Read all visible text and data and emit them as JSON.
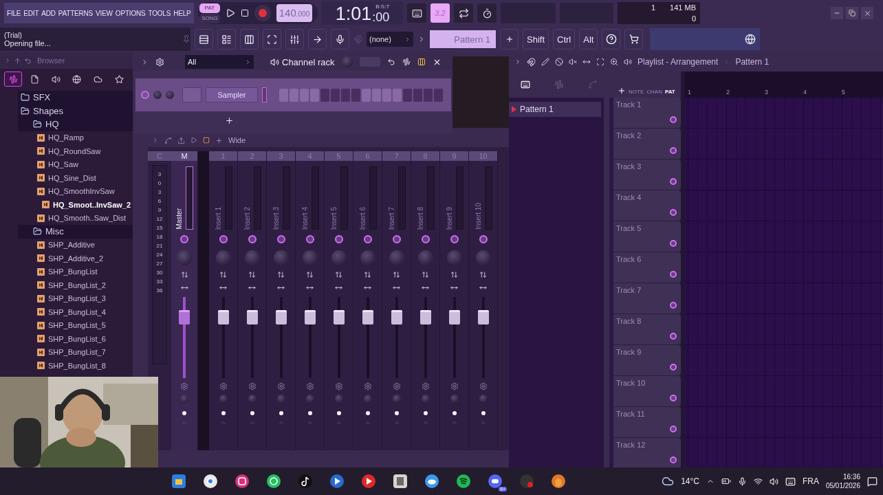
{
  "menu": [
    "FILE",
    "EDIT",
    "ADD",
    "PATTERNS",
    "VIEW",
    "OPTIONS",
    "TOOLS",
    "HELP"
  ],
  "transport": {
    "modes": [
      {
        "label": "PAT",
        "selected": true
      },
      {
        "label": "SONG",
        "selected": false
      }
    ],
    "tempo": "140",
    "tempo_fraction": ".000",
    "time": "1:01",
    "time_ticks": ":00",
    "time_format": "B:S:T"
  },
  "toggles": [
    {
      "kind": "keyboard",
      "on": false
    },
    {
      "kind": "countdown",
      "label": "3.2",
      "on": true
    },
    {
      "kind": "loop",
      "on": false
    },
    {
      "kind": "metronome",
      "on": false
    }
  ],
  "monitor": {
    "voices": "1",
    "memory": "141 MB",
    "value": "0"
  },
  "hint": {
    "title": "(Trial)",
    "text": "Opening file..."
  },
  "input_selector": "(none)",
  "pattern_selector": "Pattern 1",
  "modifiers": [
    "Shift",
    "Ctrl",
    "Alt"
  ],
  "browser": {
    "title": "Browser",
    "tabs": [
      {
        "selected": true
      },
      {
        "selected": false
      },
      {
        "selected": false
      },
      {
        "selected": false
      },
      {
        "selected": false
      },
      {
        "selected": false
      }
    ],
    "tree": [
      {
        "label": "SFX",
        "kind": "folder",
        "expanded": false,
        "selected": false
      },
      {
        "label": "Shapes",
        "kind": "folder",
        "expanded": true,
        "selected": false,
        "children": [
          {
            "label": "HQ",
            "kind": "folder",
            "expanded": true,
            "selected": false,
            "children": [
              {
                "label": "HQ_Ramp",
                "kind": "file",
                "selected": false
              },
              {
                "label": "HQ_RoundSaw",
                "kind": "file",
                "selected": false
              },
              {
                "label": "HQ_Saw",
                "kind": "file",
                "selected": false
              },
              {
                "label": "HQ_Sine_Dist",
                "kind": "file",
                "selected": false
              },
              {
                "label": "HQ_SmoothInvSaw",
                "kind": "file",
                "selected": false
              },
              {
                "label": "HQ_Smoot..InvSaw_2",
                "kind": "file",
                "selected": true
              },
              {
                "label": "HQ_Smooth..Saw_Dist",
                "kind": "file",
                "selected": false
              }
            ]
          },
          {
            "label": "Misc",
            "kind": "folder",
            "expanded": true,
            "selected": false,
            "children": [
              {
                "label": "SHP_Additive",
                "kind": "file",
                "selected": false
              },
              {
                "label": "SHP_Additive_2",
                "kind": "file",
                "selected": false
              },
              {
                "label": "SHP_BungList",
                "kind": "file",
                "selected": false
              },
              {
                "label": "SHP_BungList_2",
                "kind": "file",
                "selected": false
              },
              {
                "label": "SHP_BungList_3",
                "kind": "file",
                "selected": false
              },
              {
                "label": "SHP_BungList_4",
                "kind": "file",
                "selected": false
              },
              {
                "label": "SHP_BungList_5",
                "kind": "file",
                "selected": false
              },
              {
                "label": "SHP_BungList_6",
                "kind": "file",
                "selected": false
              },
              {
                "label": "SHP_BungList_7",
                "kind": "file",
                "selected": false
              },
              {
                "label": "SHP_BungList_8",
                "kind": "file",
                "selected": false
              }
            ]
          }
        ]
      }
    ]
  },
  "channel_rack": {
    "filter": "All",
    "title": "Channel rack",
    "channels": [
      {
        "name": "Sampler"
      }
    ]
  },
  "mixer": {
    "preset": "Wide",
    "scale_header": "C",
    "scale": [
      "3",
      "0",
      "3",
      "6",
      "9",
      "12",
      "15",
      "18",
      "21",
      "24",
      "27",
      "30",
      "33",
      "36"
    ],
    "tracks": [
      {
        "kind": "master",
        "header": "M",
        "name": "Master",
        "level": 0.8,
        "selected": true
      },
      {
        "kind": "insert",
        "header": "1",
        "name": "Insert 1",
        "level": 0.8,
        "selected": false
      },
      {
        "kind": "insert",
        "header": "2",
        "name": "Insert 2",
        "level": 0.8,
        "selected": false
      },
      {
        "kind": "insert",
        "header": "3",
        "name": "Insert 3",
        "level": 0.8,
        "selected": false
      },
      {
        "kind": "insert",
        "header": "4",
        "name": "Insert 4",
        "level": 0.8,
        "selected": false
      },
      {
        "kind": "insert",
        "header": "5",
        "name": "Insert 5",
        "level": 0.8,
        "selected": false
      },
      {
        "kind": "insert",
        "header": "6",
        "name": "Insert 6",
        "level": 0.8,
        "selected": false
      },
      {
        "kind": "insert",
        "header": "7",
        "name": "Insert 7",
        "level": 0.8,
        "selected": false
      },
      {
        "kind": "insert",
        "header": "8",
        "name": "Insert 8",
        "level": 0.8,
        "selected": false
      },
      {
        "kind": "insert",
        "header": "9",
        "name": "Insert 9",
        "level": 0.8,
        "selected": false
      },
      {
        "kind": "insert",
        "header": "10",
        "name": "Insert 10",
        "level": 0.8,
        "selected": false
      }
    ]
  },
  "playlist": {
    "title": "Playlist - Arrangement",
    "crumb": "Pattern 1",
    "patterns": [
      {
        "name": "Pattern 1",
        "selected": true
      }
    ],
    "modes": [
      {
        "label": "NOTE",
        "selected": false
      },
      {
        "label": "CHAN",
        "selected": false
      },
      {
        "label": "PAT",
        "selected": true
      }
    ],
    "ruler": [
      "1",
      "2",
      "3",
      "4",
      "5"
    ],
    "tracks": [
      "Track 1",
      "Track 2",
      "Track 3",
      "Track 4",
      "Track 5",
      "Track 6",
      "Track 7",
      "Track 8",
      "Track 9",
      "Track 10",
      "Track 11",
      "Track 12"
    ]
  },
  "taskbar": {
    "badge": "9+",
    "weather": "14°C",
    "language": "FRA",
    "time": "16:36",
    "date": "05/01/2026"
  }
}
